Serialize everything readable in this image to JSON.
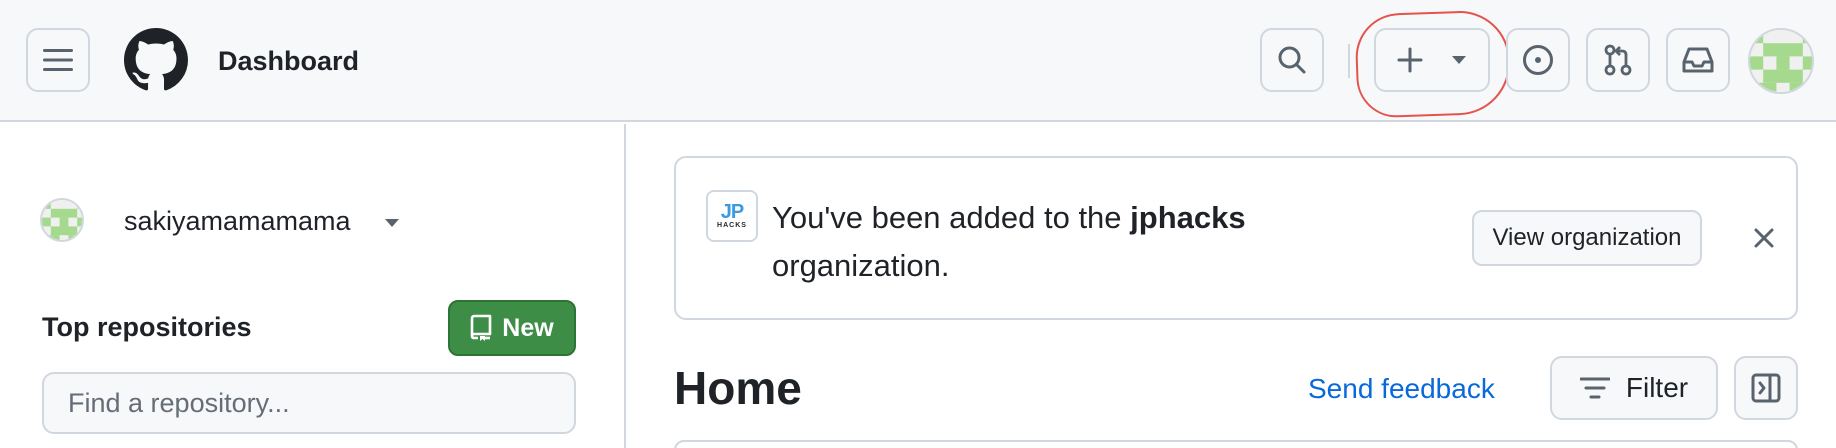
{
  "header": {
    "title": "Dashboard",
    "menu_icon": "hamburger-icon",
    "logo_icon": "github-logo-icon",
    "search_icon": "search-icon",
    "create_icons": [
      "plus-icon",
      "triangle-down-icon"
    ],
    "issues_icon": "issue-opened-icon",
    "pulls_icon": "git-pull-request-icon",
    "inbox_icon": "inbox-icon",
    "annotation_color": "#e5534b"
  },
  "sidebar": {
    "username": "sakiyamamamama",
    "top_repositories_label": "Top repositories",
    "new_button_label": "New",
    "new_button_color": "#3e8d47",
    "find_placeholder": "Find a repository..."
  },
  "banner": {
    "logo_text_main": "JP",
    "logo_text_sub": "HACKS",
    "message_prefix": "You've been added to the ",
    "org_name": "jphacks",
    "message_suffix": "organization.",
    "view_button_label": "View organization"
  },
  "main": {
    "home_title": "Home",
    "send_feedback_label": "Send feedback",
    "filter_label": "Filter",
    "link_color": "#0969da"
  }
}
